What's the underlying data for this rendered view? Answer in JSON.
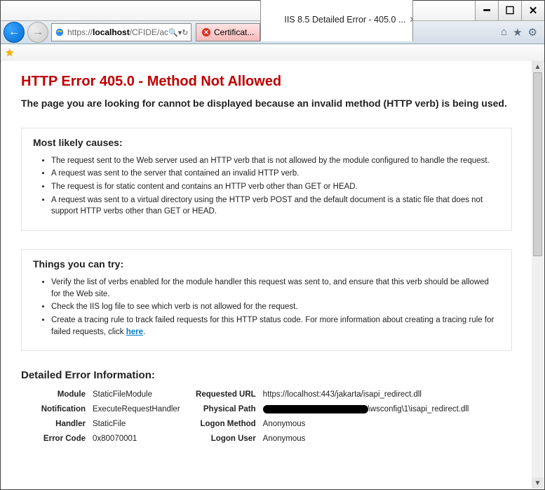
{
  "window": {
    "minimize_title": "Minimize",
    "maximize_title": "Maximize",
    "close_title": "Close"
  },
  "address_bar": {
    "url_scheme": "https://",
    "url_host": "localhost",
    "url_path": "/CFIDE/ac",
    "search_glyph": "🔍",
    "dropdown_glyph": "▾",
    "refresh_glyph": "↻"
  },
  "tabs": {
    "cert": {
      "label": "Certificat..."
    },
    "page": {
      "label": "IIS 8.5 Detailed Error - 405.0 ..."
    }
  },
  "toolbar_right": {
    "home": "⌂",
    "favorites": "★",
    "gear": "⚙"
  },
  "favorites": {
    "add_label": "Add to favorites"
  },
  "error": {
    "title": "HTTP Error 405.0 - Method Not Allowed",
    "subtitle": "The page you are looking for cannot be displayed because an invalid method (HTTP verb) is being used."
  },
  "causes": {
    "heading": "Most likely causes:",
    "items": [
      "The request sent to the Web server used an HTTP verb that is not allowed by the module configured to handle the request.",
      "A request was sent to the server that contained an invalid HTTP verb.",
      "The request is for static content and contains an HTTP verb other than GET or HEAD.",
      "A request was sent to a virtual directory using the HTTP verb POST and the default document is a static file that does not support HTTP verbs other than GET or HEAD."
    ]
  },
  "tryfix": {
    "heading": "Things you can try:",
    "items": [
      "Verify the list of verbs enabled for the module handler this request was sent to, and ensure that this verb should be allowed for the Web site.",
      "Check the IIS log file to see which verb is not allowed for the request."
    ],
    "tracing_prefix": "Create a tracing rule to track failed requests for this HTTP status code. For more information about creating a tracing rule for failed requests, click ",
    "tracing_link": "here",
    "tracing_suffix": "."
  },
  "detail": {
    "heading": "Detailed Error Information:",
    "left": {
      "module_lbl": "Module",
      "module_val": "StaticFileModule",
      "notif_lbl": "Notification",
      "notif_val": "ExecuteRequestHandler",
      "handler_lbl": "Handler",
      "handler_val": "StaticFile",
      "code_lbl": "Error Code",
      "code_val": "0x80070001"
    },
    "right": {
      "requrl_lbl": "Requested URL",
      "requrl_val": "https://localhost:443/jakarta/isapi_redirect.dll",
      "phys_lbl": "Physical Path",
      "phys_suffix": "\\wsconfig\\1\\isapi_redirect.dll",
      "logon_method_lbl": "Logon Method",
      "logon_method_val": "Anonymous",
      "logon_user_lbl": "Logon User",
      "logon_user_val": "Anonymous"
    }
  }
}
